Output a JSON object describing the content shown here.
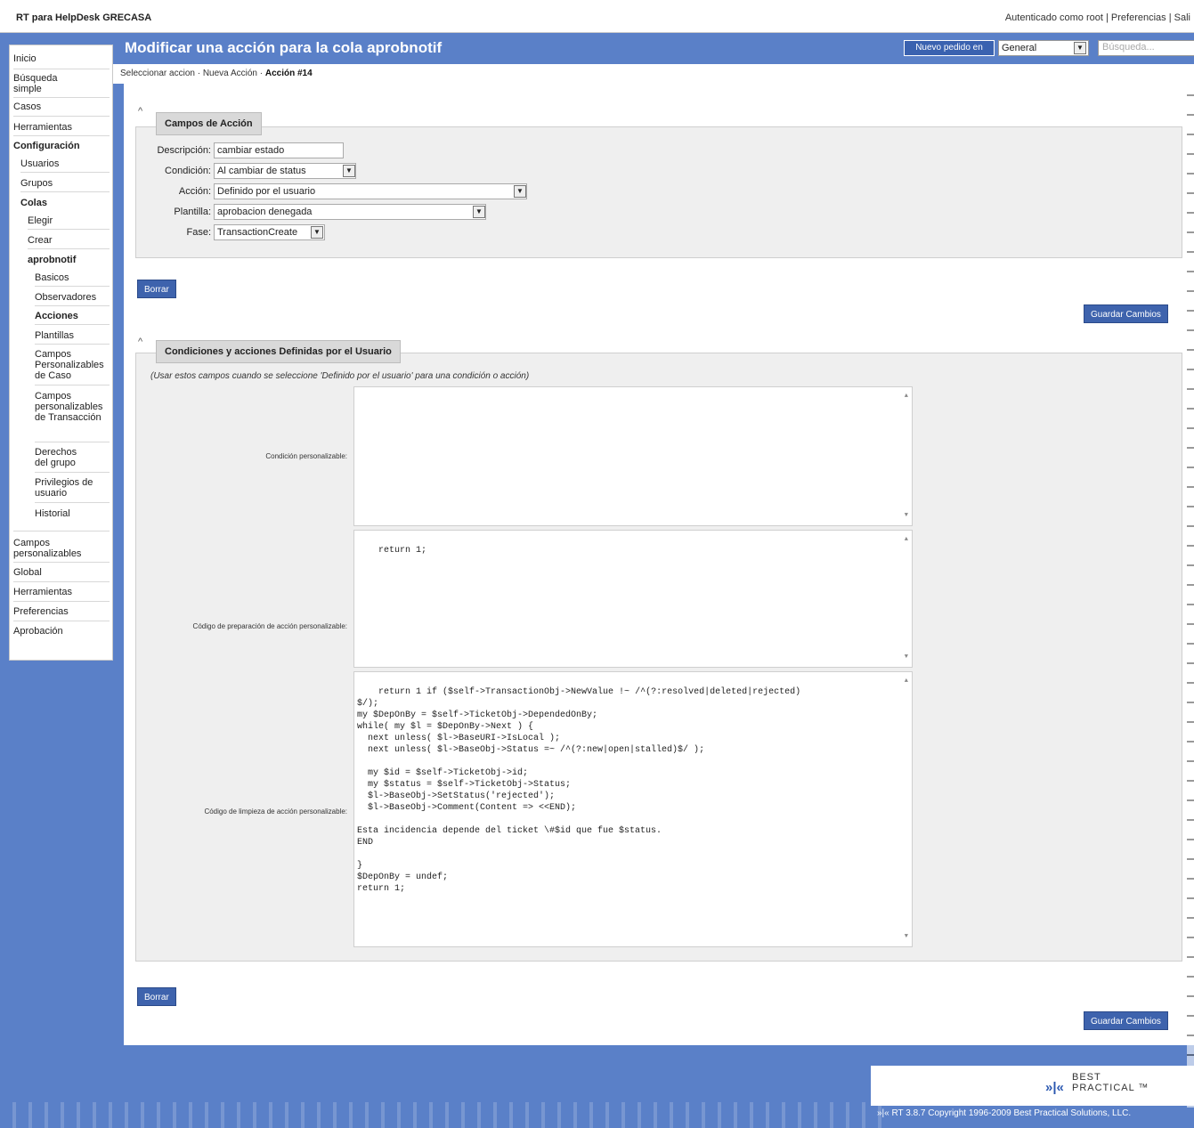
{
  "app": {
    "title": "RT para HelpDesk GRECASA",
    "auth_text": "Autenticado como root",
    "preferences_link": "Preferencias",
    "logout_link": "Sali"
  },
  "header": {
    "page_title": "Modificar una acción para la cola aprobnotif",
    "new_ticket_button": "Nuevo pedido en",
    "queue_select_value": "General",
    "search_placeholder": "Búsqueda..."
  },
  "breadcrumb": {
    "items": [
      "Seleccionar accion",
      "Nueva Acción",
      "Acción #14"
    ]
  },
  "sidebar": {
    "items": [
      {
        "label": "Inicio"
      },
      {
        "label": "Búsqueda simple"
      },
      {
        "label": "Casos"
      },
      {
        "label": "Herramientas"
      },
      {
        "label": "Configuración"
      },
      {
        "label": "Usuarios"
      },
      {
        "label": "Grupos"
      },
      {
        "label": "Colas"
      },
      {
        "label": "Elegir"
      },
      {
        "label": "Crear"
      },
      {
        "label": "aprobnotif"
      },
      {
        "label": "Basicos"
      },
      {
        "label": "Observadores"
      },
      {
        "label": "Acciones"
      },
      {
        "label": "Plantillas"
      },
      {
        "label": "Campos Personalizables de Caso"
      },
      {
        "label": "Campos personalizables de Transacción"
      },
      {
        "label": "Derechos del grupo"
      },
      {
        "label": "Privilegios de usuario"
      },
      {
        "label": "Historial"
      },
      {
        "label": "Campos personalizables"
      },
      {
        "label": "Global"
      },
      {
        "label": "Herramientas"
      },
      {
        "label": "Preferencias"
      },
      {
        "label": "Aprobación"
      }
    ]
  },
  "action_fields": {
    "title": "Campos de Acción",
    "description_label": "Descripción:",
    "description_value": "cambiar estado",
    "condition_label": "Condición:",
    "condition_value": "Al cambiar de status",
    "action_label": "Acción:",
    "action_value": "Definido por el usuario",
    "template_label": "Plantilla:",
    "template_value": "aprobacion denegada",
    "stage_label": "Fase:",
    "stage_value": "TransactionCreate"
  },
  "buttons": {
    "delete": "Borrar",
    "save": "Guardar Cambios"
  },
  "user_defined": {
    "title": "Condiciones y acciones Definidas por el Usuario",
    "note": "(Usar estos campos cuando se seleccione 'Definido por el usuario' para una condición o acción)",
    "condition_label": "Condición personalizable:",
    "condition_code": "",
    "prepare_label": "Código de preparación de acción personalizable:",
    "prepare_code": "return 1;",
    "cleanup_label": "Código de limpieza de acción personalizable:",
    "cleanup_code": "return 1 if ($self->TransactionObj->NewValue !~ /^(?:resolved|deleted|rejected)\n$/);\nmy $DepOnBy = $self->TicketObj->DependedOnBy;\nwhile( my $l = $DepOnBy->Next ) {\n  next unless( $l->BaseURI->IsLocal );\n  next unless( $l->BaseObj->Status =~ /^(?:new|open|stalled)$/ );\n\n  my $id = $self->TicketObj->id;\n  my $status = $self->TicketObj->Status;\n  $l->BaseObj->SetStatus('rejected');\n  $l->BaseObj->Comment(Content => <<END);\n\nEsta incidencia depende del ticket \\#$id que fue $status.\nEND\n\n}\n$DepOnBy = undef;\nreturn 1;"
  },
  "footer": {
    "logo_text_1": "BEST",
    "logo_text_2": "PRACTICAL ™",
    "copyright": "»|« RT 3.8.7 Copyright 1996-2009 Best Practical Solutions, LLC."
  },
  "colors": {
    "header_blue": "#5a80c8",
    "button_blue": "#3e63ad"
  }
}
